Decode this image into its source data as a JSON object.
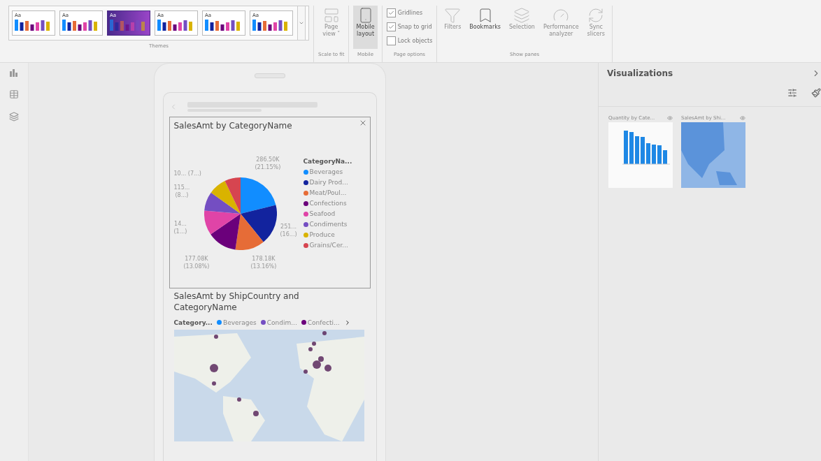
{
  "ribbon": {
    "themes": [
      {
        "label": "Aa",
        "selected": false
      },
      {
        "label": "Aa",
        "selected": false
      },
      {
        "label": "Aa",
        "selected": true
      },
      {
        "label": "Aa",
        "selected": false
      },
      {
        "label": "Aa",
        "selected": false
      },
      {
        "label": "Aa",
        "selected": false
      }
    ],
    "groups": [
      {
        "kind": "themes",
        "label": "Themes"
      },
      {
        "kind": "scale",
        "label": "Scale to fit",
        "buttons": [
          {
            "lines": [
              "Page",
              "view ˅"
            ],
            "selected": false,
            "disabled": true
          }
        ]
      },
      {
        "kind": "mobile",
        "label": "Mobile",
        "buttons": [
          {
            "lines": [
              "Mobile",
              "layout"
            ],
            "selected": true,
            "disabled": false
          }
        ]
      },
      {
        "kind": "options",
        "label": "Page options",
        "checks": [
          {
            "label": "Gridlines",
            "checked": true
          },
          {
            "label": "Snap to grid",
            "checked": true
          },
          {
            "label": "Lock objects",
            "checked": false
          }
        ]
      },
      {
        "kind": "panes",
        "label": "Show panes",
        "buttons": [
          {
            "lines": [
              "Filters"
            ],
            "disabled": true,
            "selected": false
          },
          {
            "lines": [
              "Bookmarks"
            ],
            "disabled": false,
            "selected": false
          },
          {
            "lines": [
              "Selection"
            ],
            "disabled": true,
            "selected": false
          },
          {
            "lines": [
              "Performance",
              "analyzer"
            ],
            "disabled": true,
            "selected": false
          },
          {
            "lines": [
              "Sync",
              "slicers"
            ],
            "disabled": true,
            "selected": false
          }
        ]
      }
    ]
  },
  "phone": {
    "visuals": [
      {
        "kind": "pie",
        "title": "SalesAmt by CategoryName",
        "data_labels": [
          {
            "lines": [
              "286.50K",
              "(21.15%)"
            ]
          },
          {
            "lines": [
              "10... (7...)"
            ]
          },
          {
            "lines": [
              "115...",
              "(8...)"
            ]
          },
          {
            "lines": [
              "14...",
              "(1...)"
            ]
          },
          {
            "lines": [
              "251...",
              "(16...)"
            ]
          },
          {
            "lines": [
              "177.08K",
              "(13.08%)"
            ]
          },
          {
            "lines": [
              "178.18K",
              "(13.16%)"
            ]
          }
        ],
        "legend_title": "CategoryNa...",
        "legend": [
          {
            "label": "Beverages",
            "color": "#118dff"
          },
          {
            "label": "Dairy Prod...",
            "color": "#12239e"
          },
          {
            "label": "Meat/Poul...",
            "color": "#e66c37"
          },
          {
            "label": "Confections",
            "color": "#6b007b"
          },
          {
            "label": "Seafood",
            "color": "#e044a7"
          },
          {
            "label": "Condiments",
            "color": "#744ec2"
          },
          {
            "label": "Produce",
            "color": "#d9b300"
          },
          {
            "label": "Grains/Cer...",
            "color": "#d64550"
          }
        ]
      },
      {
        "kind": "map",
        "title": "SalesAmt by ShipCountry and CategoryName",
        "legend_title": "Category...",
        "legend": [
          {
            "label": "Beverages",
            "color": "#118dff"
          },
          {
            "label": "Condim...",
            "color": "#744ec2"
          },
          {
            "label": "Confecti...",
            "color": "#6b007b"
          }
        ]
      }
    ]
  },
  "visualizations": {
    "title": "Visualizations",
    "thumbnails": [
      {
        "kind": "bar",
        "title": "Quantity by Cate..."
      },
      {
        "kind": "map",
        "title": "SalesAmt by Shi..."
      }
    ]
  }
}
